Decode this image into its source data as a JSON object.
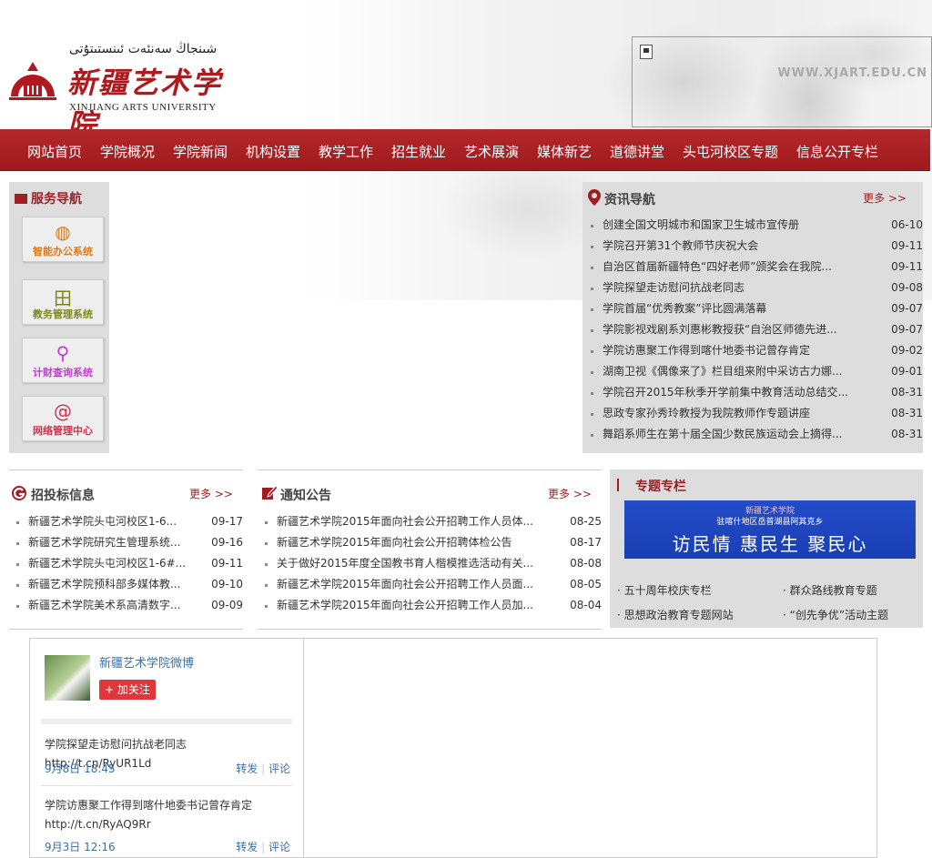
{
  "logo": {
    "uyghur": "شىنجاڭ سەنئەت ئىنستىتۇتى",
    "chinese": "新疆艺术学院",
    "english": "XINJIANG ARTS UNIVERSITY"
  },
  "banner": {
    "url": "WWW.XJART.EDU.CN"
  },
  "nav": [
    "网站首页",
    "学院概况",
    "学院新闻",
    "机构设置",
    "教学工作",
    "招生就业",
    "艺术展演",
    "媒体新艺",
    "道德讲堂",
    "头屯河校区专题",
    "信息公开专栏"
  ],
  "service": {
    "title": "服务导航",
    "items": [
      {
        "label": "智能办公系统",
        "icon": "globe-icon",
        "color": "#e07a10"
      },
      {
        "label": "教务管理系统",
        "icon": "grid-icon",
        "color": "#7a8a1a"
      },
      {
        "label": "计财查询系统",
        "icon": "magnifier-icon",
        "color": "#c23bd0"
      },
      {
        "label": "网络管理中心",
        "icon": "at-icon",
        "color": "#d0304a"
      }
    ]
  },
  "news": {
    "title": "资讯导航",
    "more": "更多 >>",
    "items": [
      {
        "title": "创建全国文明城市和国家卫生城市宣传册",
        "date": "06-10"
      },
      {
        "title": "学院召开第31个教师节庆祝大会",
        "date": "09-11"
      },
      {
        "title": "自治区首届新疆特色“四好老师”颁奖会在我院...",
        "date": "09-11"
      },
      {
        "title": "学院探望走访慰问抗战老同志",
        "date": "09-08"
      },
      {
        "title": "学院首届“优秀教案”评比圆满落幕",
        "date": "09-07"
      },
      {
        "title": "学院影视戏剧系刘惠彬教授获“自治区师德先进...",
        "date": "09-07"
      },
      {
        "title": "学院访惠聚工作得到喀什地委书记曾存肯定",
        "date": "09-02"
      },
      {
        "title": "湖南卫视《偶像来了》栏目组来附中采访古力娜...",
        "date": "09-01"
      },
      {
        "title": "学院召开2015年秋季开学前集中教育活动总结交...",
        "date": "08-31"
      },
      {
        "title": "思政专家孙秀玲教授为我院教师作专题讲座",
        "date": "08-31"
      },
      {
        "title": "舞蹈系师生在第十届全国少数民族运动会上摘得...",
        "date": "08-31"
      }
    ]
  },
  "tender": {
    "title": "招投标信息",
    "more": "更多 >>",
    "items": [
      {
        "title": "新疆艺术学院头屯河校区1-6...",
        "date": "09-17"
      },
      {
        "title": "新疆艺术学院研究生管理系统...",
        "date": "09-16"
      },
      {
        "title": "新疆艺术学院头屯河校区1-6#...",
        "date": "09-11"
      },
      {
        "title": "新疆艺术学院预科部多媒体教...",
        "date": "09-10"
      },
      {
        "title": "新疆艺术学院美术系高清数字...",
        "date": "09-09"
      }
    ]
  },
  "notice": {
    "title": "通知公告",
    "more": "更多 >>",
    "items": [
      {
        "title": "新疆艺术学院2015年面向社会公开招聘工作人员体...",
        "date": "08-25"
      },
      {
        "title": "新疆艺术学院2015年面向社会公开招聘体检公告",
        "date": "08-17"
      },
      {
        "title": "关于做好2015年度全国教书育人楷模推选活动有关...",
        "date": "08-08"
      },
      {
        "title": "新疆艺术学院2015年面向社会公开招聘工作人员面...",
        "date": "08-05"
      },
      {
        "title": "新疆艺术学院2015年面向社会公开招聘工作人员加...",
        "date": "08-04"
      }
    ]
  },
  "topic": {
    "title": "专题专栏",
    "banner_line1": "新疆艺术学院",
    "banner_line2": "驻喀什地区岳普湖县阿其克乡",
    "banner_line3": "访民情  惠民生  聚民心",
    "links": [
      "五十周年校庆专栏",
      "群众路线教育专题",
      "思想政治教育专题网站",
      "“创先争优”活动主题"
    ]
  },
  "weibo": {
    "name": "新疆艺术学院微博",
    "follow": "加关注",
    "posts": [
      {
        "text": "学院探望走访慰问抗战老同志http://t.cn/RyUR1Ld",
        "time": "9月8日 18:45",
        "repost": "转发",
        "comment": "评论"
      },
      {
        "text": "学院访惠聚工作得到喀什地委书记曾存肯定 http://t.cn/RyAQ9Rr",
        "time": "9月3日 12:16",
        "repost": "转发",
        "comment": "评论"
      }
    ]
  }
}
